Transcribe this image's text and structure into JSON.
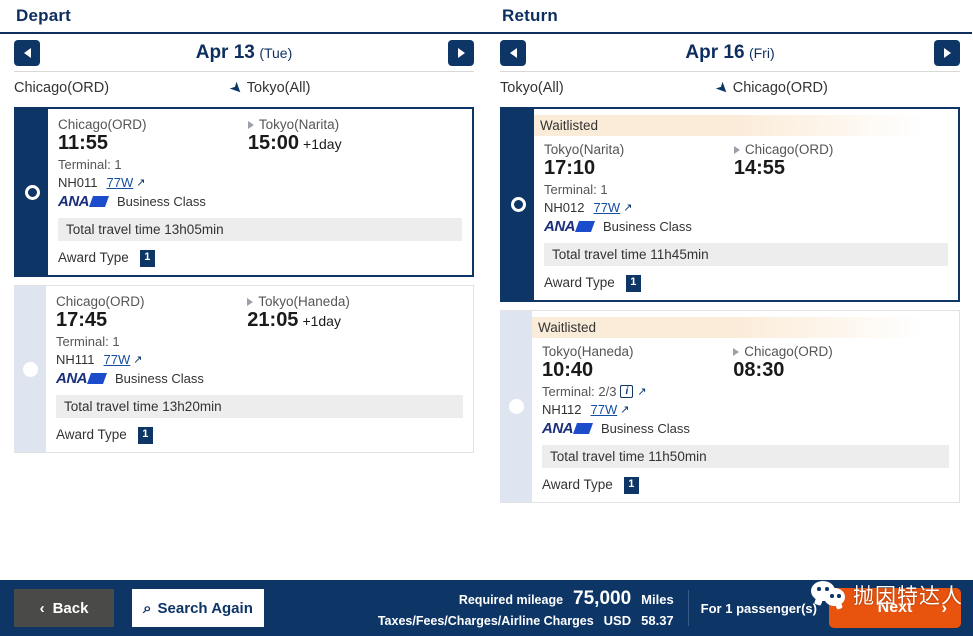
{
  "depart": {
    "title": "Depart",
    "date": "Apr 13",
    "weekday": "(Tue)",
    "prev_label": "◀",
    "next_label": "▶",
    "route_from": "Chicago(ORD)",
    "route_to": "Tokyo(All)",
    "flights": [
      {
        "selected": true,
        "status": "",
        "origin_city": "Chicago(ORD)",
        "dest_city": "Tokyo(Narita)",
        "dep_time": "11:55",
        "arr_time": "15:00",
        "arr_offset": "+1day",
        "terminal": "Terminal: 1",
        "terminal_info_icon": "",
        "flight_no": "NH011",
        "equipment": "77W",
        "airline": "ANA",
        "cabin": "Business Class",
        "travel_time": "Total travel time 13h05min",
        "award_label": "Award Type",
        "award_value": "1"
      },
      {
        "selected": false,
        "status": "",
        "origin_city": "Chicago(ORD)",
        "dest_city": "Tokyo(Haneda)",
        "dep_time": "17:45",
        "arr_time": "21:05",
        "arr_offset": "+1day",
        "terminal": "Terminal: 1",
        "terminal_info_icon": "",
        "flight_no": "NH111",
        "equipment": "77W",
        "airline": "ANA",
        "cabin": "Business Class",
        "travel_time": "Total travel time 13h20min",
        "award_label": "Award Type",
        "award_value": "1"
      }
    ]
  },
  "return": {
    "title": "Return",
    "date": "Apr 16",
    "weekday": "(Fri)",
    "prev_label": "◀",
    "next_label": "▶",
    "route_from": "Tokyo(All)",
    "route_to": "Chicago(ORD)",
    "flights": [
      {
        "selected": true,
        "status": "Waitlisted",
        "origin_city": "Tokyo(Narita)",
        "dest_city": "Chicago(ORD)",
        "dep_time": "17:10",
        "arr_time": "14:55",
        "arr_offset": "",
        "terminal": "Terminal: 1",
        "terminal_info_icon": "",
        "flight_no": "NH012",
        "equipment": "77W",
        "airline": "ANA",
        "cabin": "Business Class",
        "travel_time": "Total travel time 11h45min",
        "award_label": "Award Type",
        "award_value": "1"
      },
      {
        "selected": false,
        "status": "Waitlisted",
        "origin_city": "Tokyo(Haneda)",
        "dest_city": "Chicago(ORD)",
        "dep_time": "10:40",
        "arr_time": "08:30",
        "arr_offset": "",
        "terminal": "Terminal: 2/3",
        "terminal_info_icon": "i",
        "flight_no": "NH112",
        "equipment": "77W",
        "airline": "ANA",
        "cabin": "Business Class",
        "travel_time": "Total travel time 11h50min",
        "award_label": "Award Type",
        "award_value": "1"
      }
    ]
  },
  "footer": {
    "back_label": "Back",
    "back_icon": "‹",
    "search_label": "Search Again",
    "search_icon": "⌕",
    "mileage_label": "Required mileage",
    "mileage_value": "75,000",
    "mileage_unit": "Miles",
    "taxes_label": "Taxes/Fees/Charges/Airline Charges",
    "taxes_currency": "USD",
    "taxes_value": "58.37",
    "passengers": "For 1 passenger(s)",
    "next_label": "Next",
    "next_icon": "›"
  },
  "watermark": {
    "text": "抛因特达人"
  },
  "colors": {
    "navy": "#0d3566",
    "navy_dark": "#0d2e5e",
    "orange": "#e8530e",
    "waitlist_bg": "#fbecd9",
    "rail_unselected": "#dfe4f1",
    "link": "#1450a0",
    "ana_navy": "#1a2e7a",
    "ana_blue": "#1b4ccb"
  }
}
